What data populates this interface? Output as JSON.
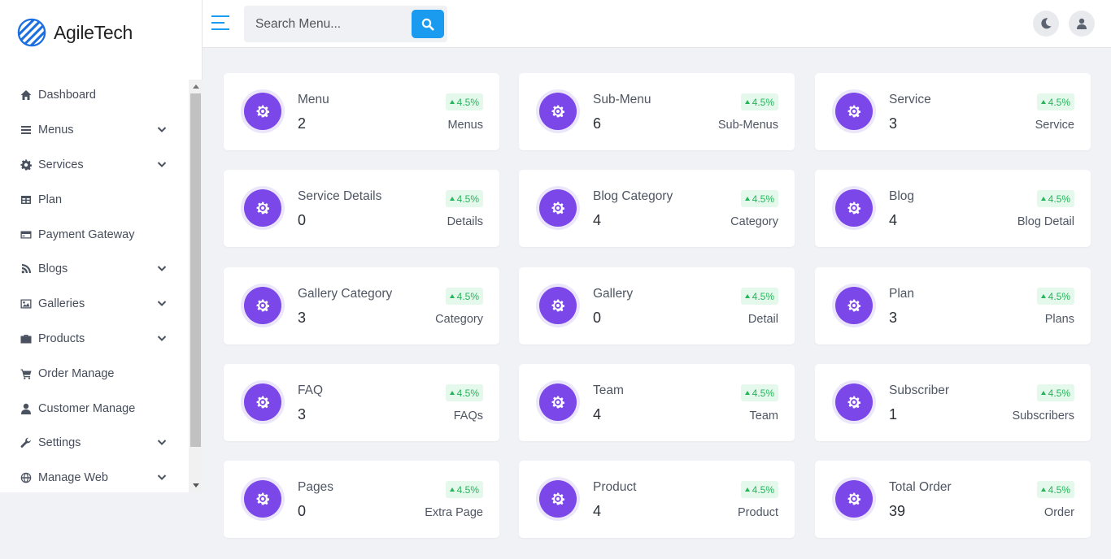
{
  "brand": {
    "name": "AgileTech"
  },
  "sidebar": {
    "items": [
      {
        "label": "Dashboard",
        "icon": "home-icon",
        "has_submenu": false
      },
      {
        "label": "Menus",
        "icon": "bars-icon",
        "has_submenu": true
      },
      {
        "label": "Services",
        "icon": "cog-icon",
        "has_submenu": true
      },
      {
        "label": "Plan",
        "icon": "table-icon",
        "has_submenu": false
      },
      {
        "label": "Payment Gateway",
        "icon": "credit-card-icon",
        "has_submenu": false
      },
      {
        "label": "Blogs",
        "icon": "blog-icon",
        "has_submenu": true
      },
      {
        "label": "Galleries",
        "icon": "image-icon",
        "has_submenu": true
      },
      {
        "label": "Products",
        "icon": "briefcase-icon",
        "has_submenu": true
      },
      {
        "label": "Order Manage",
        "icon": "cart-icon",
        "has_submenu": false
      },
      {
        "label": "Customer Manage",
        "icon": "user-icon",
        "has_submenu": false
      },
      {
        "label": "Settings",
        "icon": "wrench-icon",
        "has_submenu": true
      },
      {
        "label": "Manage Web",
        "icon": "globe-icon",
        "has_submenu": true
      }
    ]
  },
  "header": {
    "search_placeholder": "Search Menu...",
    "menu_toggle_icon": "hamburger-icon",
    "search_icon": "search-icon",
    "theme_icon": "moon-icon",
    "profile_icon": "user-icon"
  },
  "colors": {
    "accent": "#1b9bf0",
    "card_icon": "#7b47e8",
    "badge_text": "#26b55a",
    "badge_bg": "#e4f8ec"
  },
  "cards": [
    {
      "title": "Menu",
      "value": "2",
      "badge": "4.5%",
      "sub": "Menus"
    },
    {
      "title": "Sub-Menu",
      "value": "6",
      "badge": "4.5%",
      "sub": "Sub-Menus"
    },
    {
      "title": "Service",
      "value": "3",
      "badge": "4.5%",
      "sub": "Service"
    },
    {
      "title": "Service Details",
      "value": "0",
      "badge": "4.5%",
      "sub": "Details"
    },
    {
      "title": "Blog Category",
      "value": "4",
      "badge": "4.5%",
      "sub": "Category"
    },
    {
      "title": "Blog",
      "value": "4",
      "badge": "4.5%",
      "sub": "Blog Detail"
    },
    {
      "title": "Gallery Category",
      "value": "3",
      "badge": "4.5%",
      "sub": "Category"
    },
    {
      "title": "Gallery",
      "value": "0",
      "badge": "4.5%",
      "sub": "Detail"
    },
    {
      "title": "Plan",
      "value": "3",
      "badge": "4.5%",
      "sub": "Plans"
    },
    {
      "title": "FAQ",
      "value": "3",
      "badge": "4.5%",
      "sub": "FAQs"
    },
    {
      "title": "Team",
      "value": "4",
      "badge": "4.5%",
      "sub": "Team"
    },
    {
      "title": "Subscriber",
      "value": "1",
      "badge": "4.5%",
      "sub": "Subscribers"
    },
    {
      "title": "Pages",
      "value": "0",
      "badge": "4.5%",
      "sub": "Extra Page"
    },
    {
      "title": "Product",
      "value": "4",
      "badge": "4.5%",
      "sub": "Product"
    },
    {
      "title": "Total Order",
      "value": "39",
      "badge": "4.5%",
      "sub": "Order"
    }
  ]
}
